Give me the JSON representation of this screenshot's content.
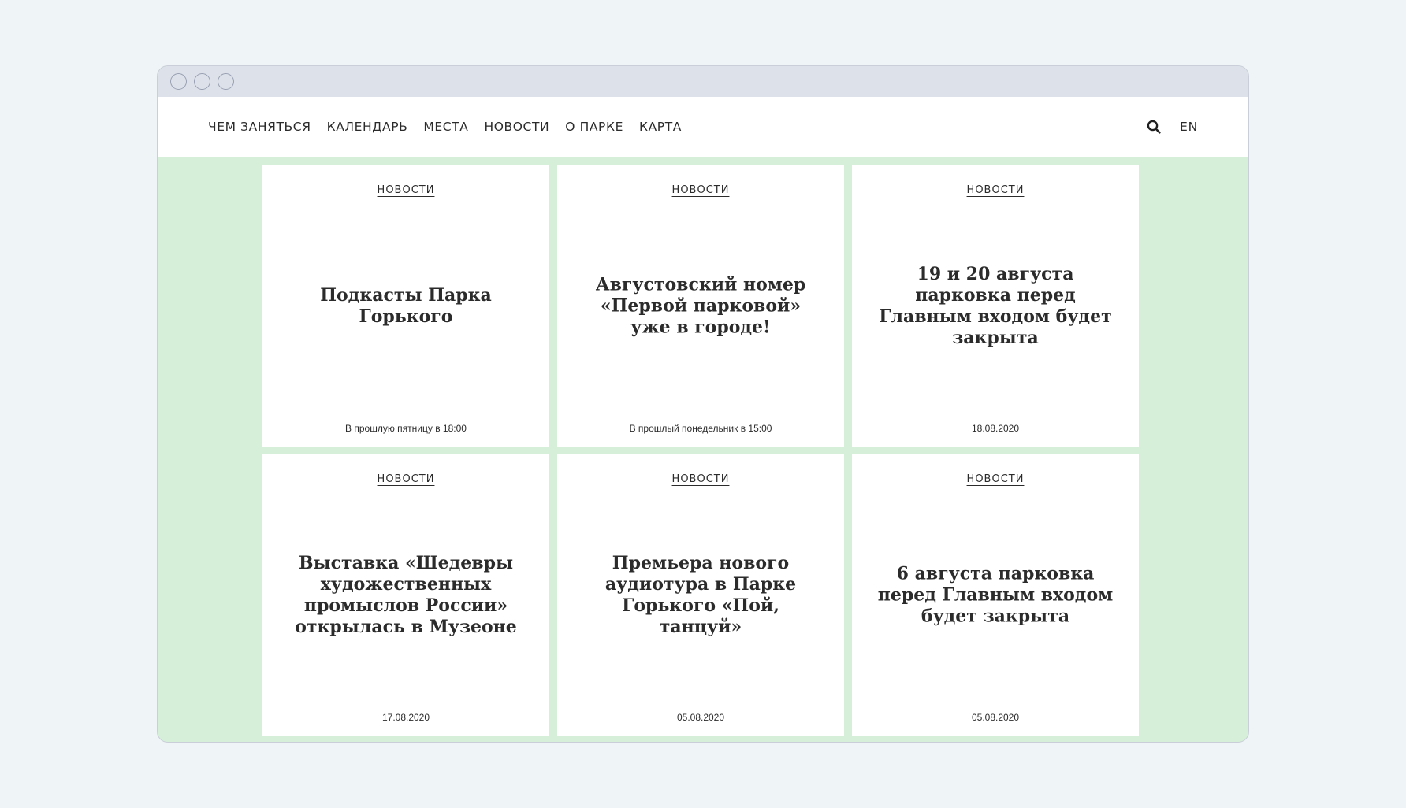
{
  "nav": {
    "items": [
      {
        "label": "ЧЕМ ЗАНЯТЬСЯ"
      },
      {
        "label": "КАЛЕНДАРЬ"
      },
      {
        "label": "МЕСТА"
      },
      {
        "label": "НОВОСТИ"
      },
      {
        "label": "О ПАРКЕ"
      },
      {
        "label": "КАРТА"
      }
    ],
    "search_icon": "search-icon",
    "lang": "EN"
  },
  "cards": [
    {
      "category": "НОВОСТИ",
      "title": "Подкасты Парка Горького",
      "date": "В прошлую пятницу в 18:00"
    },
    {
      "category": "НОВОСТИ",
      "title": "Августовский номер «Первой парковой» уже в городе!",
      "date": "В прошлый понедельник в 15:00"
    },
    {
      "category": "НОВОСТИ",
      "title": "19 и 20 августа парковка перед Главным входом будет закрыта",
      "date": "18.08.2020"
    },
    {
      "category": "НОВОСТИ",
      "title": "Выставка «Шедевры художественных промыслов России» открылась в Музеоне",
      "date": "17.08.2020"
    },
    {
      "category": "НОВОСТИ",
      "title": "Премьера нового аудиотура в Парке Горького «Пой, танцуй»",
      "date": "05.08.2020"
    },
    {
      "category": "НОВОСТИ",
      "title": "6 августа парковка перед Главным входом будет закрыта",
      "date": "05.08.2020"
    }
  ],
  "colors": {
    "background": "#eff4f7",
    "titlebar": "#dde2ea",
    "content_bg": "#d5efd9",
    "text": "#2b2b2b"
  }
}
